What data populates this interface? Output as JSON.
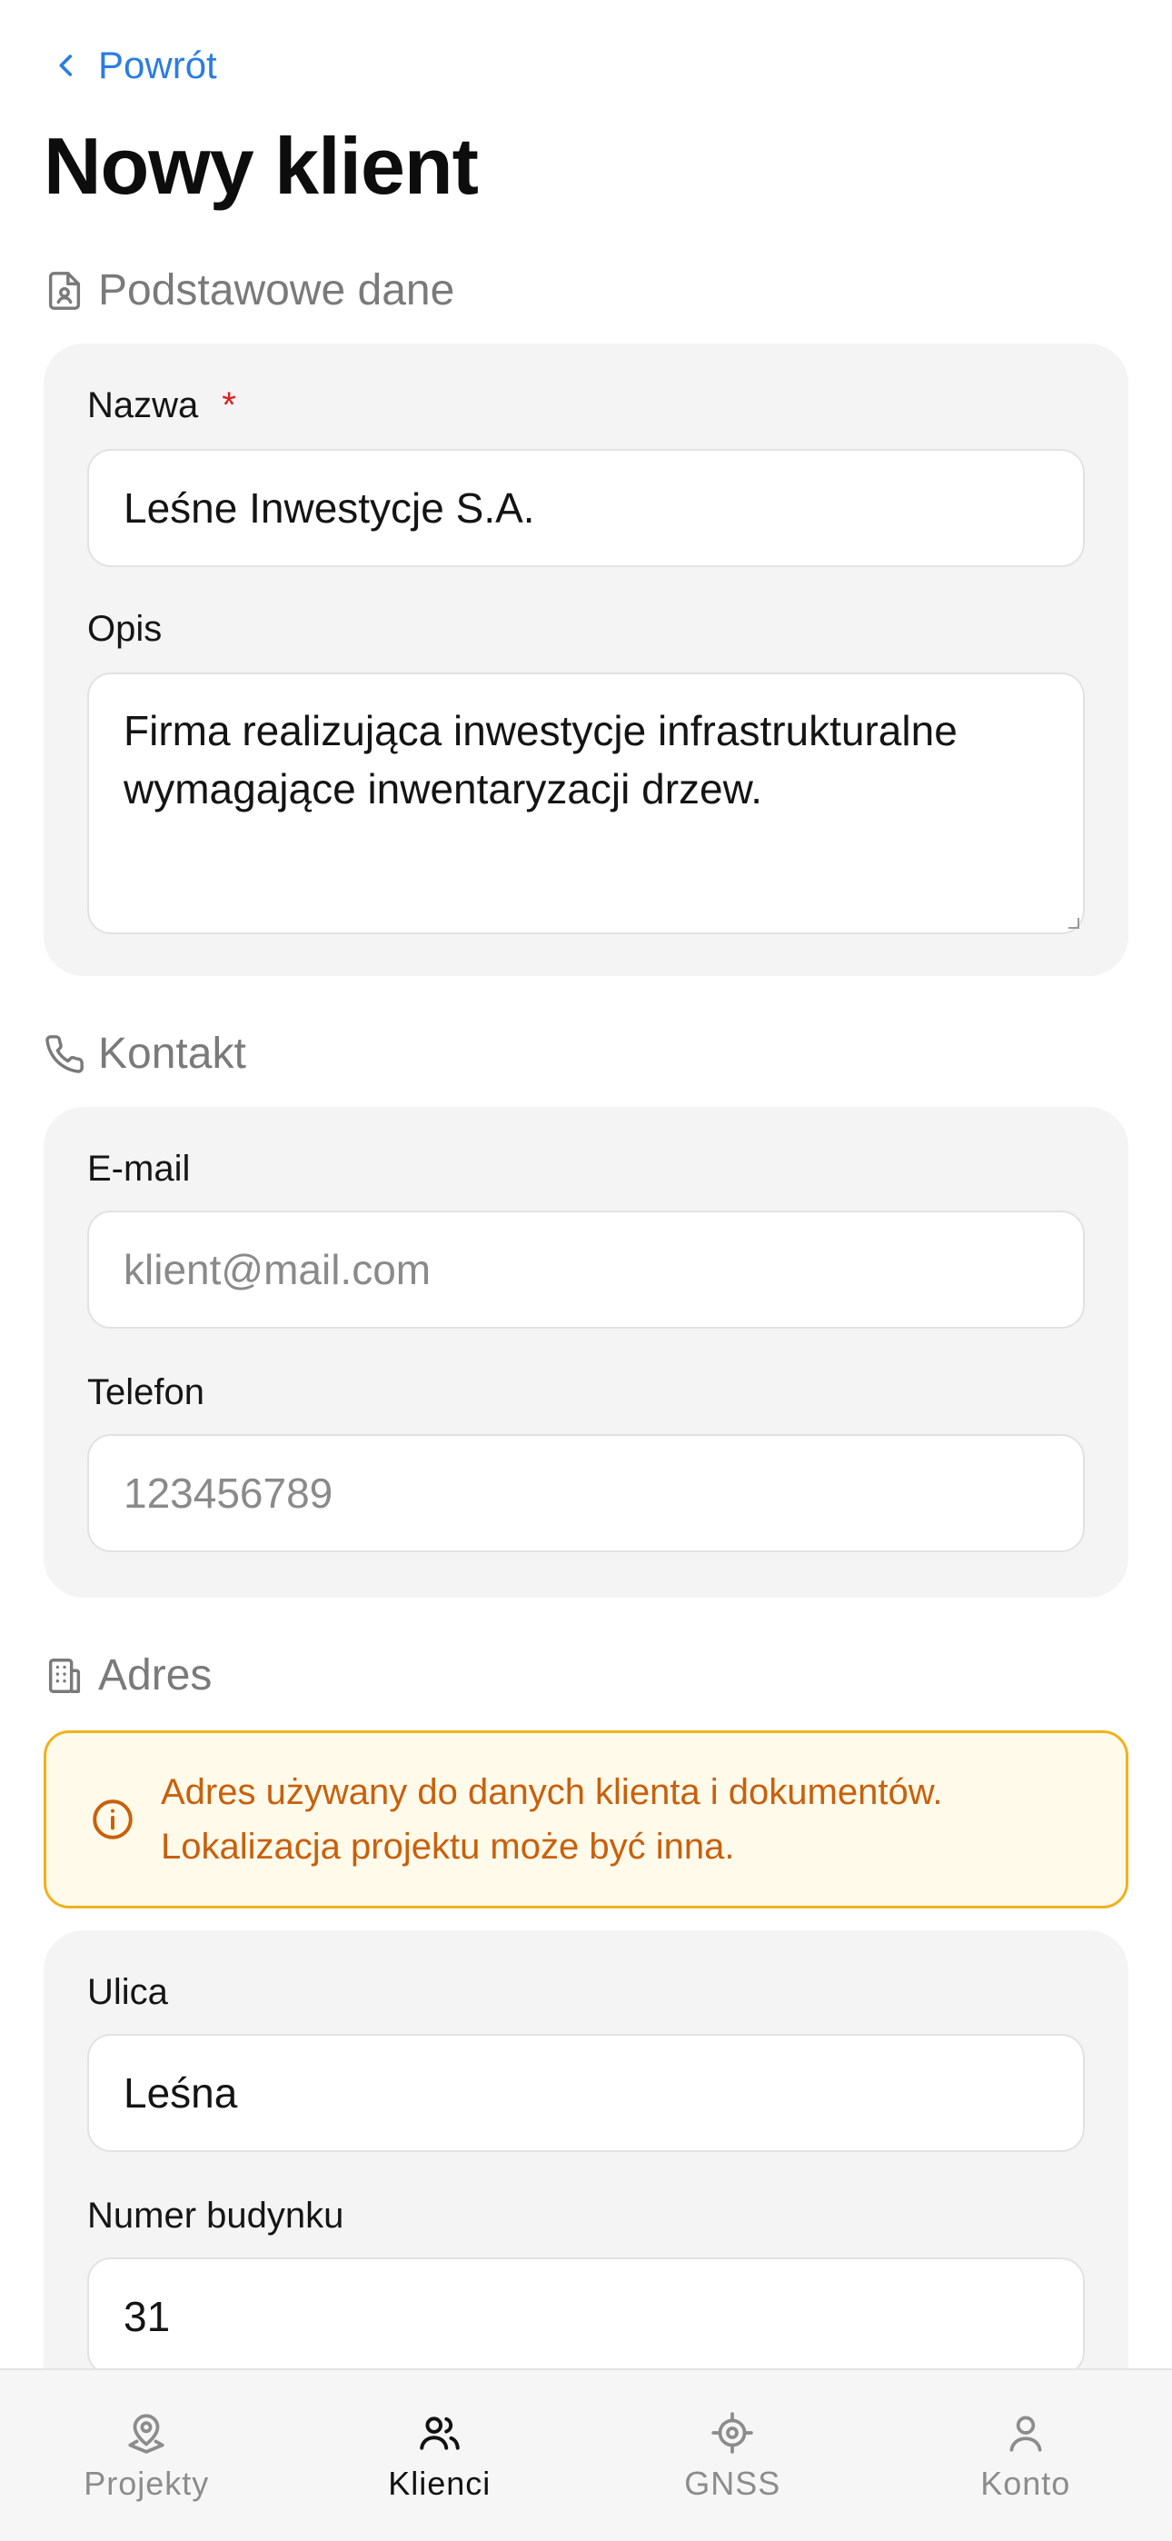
{
  "nav": {
    "back_label": "Powrót"
  },
  "page": {
    "title": "Nowy klient"
  },
  "sections": {
    "basic": {
      "title": "Podstawowe dane"
    },
    "contact": {
      "title": "Kontakt"
    },
    "address": {
      "title": "Adres"
    }
  },
  "fields": {
    "name": {
      "label": "Nazwa",
      "required_mark": "*",
      "value": "Leśne Inwestycje S.A."
    },
    "description": {
      "label": "Opis",
      "value": "Firma realizująca inwestycje infrastrukturalne wymagające inwentaryzacji drzew."
    },
    "email": {
      "label": "E-mail",
      "placeholder": "klient@mail.com"
    },
    "phone": {
      "label": "Telefon",
      "placeholder": "123456789"
    },
    "street": {
      "label": "Ulica",
      "value": "Leśna"
    },
    "building": {
      "label": "Numer budynku",
      "value": "31"
    }
  },
  "address_notice": {
    "line1": "Adres używany do danych klienta i dokumentów.",
    "line2": "Lokalizacja projektu może być inna."
  },
  "tabbar": {
    "active": "Klienci",
    "items": [
      {
        "label": "Projekty",
        "icon": "map-pin-icon"
      },
      {
        "label": "Klienci",
        "icon": "users-icon"
      },
      {
        "label": "GNSS",
        "icon": "crosshair-icon"
      },
      {
        "label": "Konto",
        "icon": "user-icon"
      }
    ]
  },
  "colors": {
    "accent": "#2b7de0",
    "required": "#e02020",
    "warning_text": "#c8600c",
    "warning_border": "#f0b21c",
    "warning_bg": "#fffaea",
    "card_bg": "#f4f4f4"
  }
}
